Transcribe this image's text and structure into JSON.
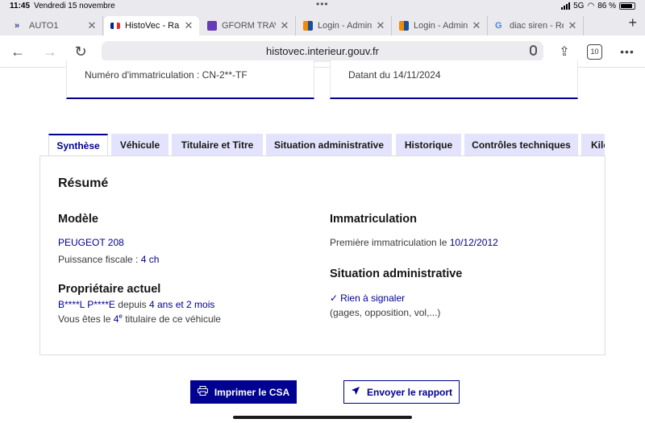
{
  "status_bar": {
    "time": "11:45",
    "date": "Vendredi 15 novembre",
    "network": "5G",
    "battery": "86 %"
  },
  "browser": {
    "tabs": [
      {
        "title": "AUTO1",
        "icon": "chevrons-icon",
        "active": false
      },
      {
        "title": "HistoVec - Rapport",
        "icon": "french-flag-icon",
        "active": true
      },
      {
        "title": "GFORM TRAVAIL",
        "icon": "form-icon",
        "active": false
      },
      {
        "title": "Login - Admin CRM",
        "icon": "grid-logo-icon",
        "active": false
      },
      {
        "title": "Login - Admin CRM",
        "icon": "grid-logo-icon",
        "active": false
      },
      {
        "title": "diac siren - Recherche",
        "icon": "google-icon",
        "active": false
      }
    ],
    "url": "histovec.interieur.gouv.fr",
    "tab_count": "10"
  },
  "page": {
    "cards": {
      "left": "Numéro d'immatriculation : CN-2**-TF",
      "right": "Datant du 14/11/2024"
    },
    "tabs": [
      "Synthèse",
      "Véhicule",
      "Titulaire et Titre",
      "Situation administrative",
      "Historique",
      "Contrôles techniques",
      "Kilométrage"
    ],
    "resume_title": "Résumé",
    "modele": {
      "title": "Modèle",
      "name": "PEUGEOT 208",
      "puissance_label": "Puissance fiscale :",
      "puissance_value": "4 ch"
    },
    "proprietaire": {
      "title": "Propriétaire actuel",
      "name": "B****L P****E",
      "depuis_label": "depuis",
      "duree": "4 ans et 2 mois",
      "titulaire_prefix": "Vous êtes le",
      "rang": "4",
      "rang_suffix": "e",
      "titulaire_suffix": "titulaire de ce véhicule"
    },
    "immatriculation": {
      "title": "Immatriculation",
      "label": "Première immatriculation le",
      "date": "10/12/2012"
    },
    "situation": {
      "title": "Situation administrative",
      "status": "Rien à signaler",
      "details": "(gages, opposition, vol,...)"
    },
    "buttons": {
      "print": "Imprimer le CSA",
      "send": "Envoyer le rapport"
    }
  },
  "colors": {
    "primary": "#000091",
    "tab_bg": "#e3e3fd",
    "chrome_bg": "#e9e9ee"
  }
}
